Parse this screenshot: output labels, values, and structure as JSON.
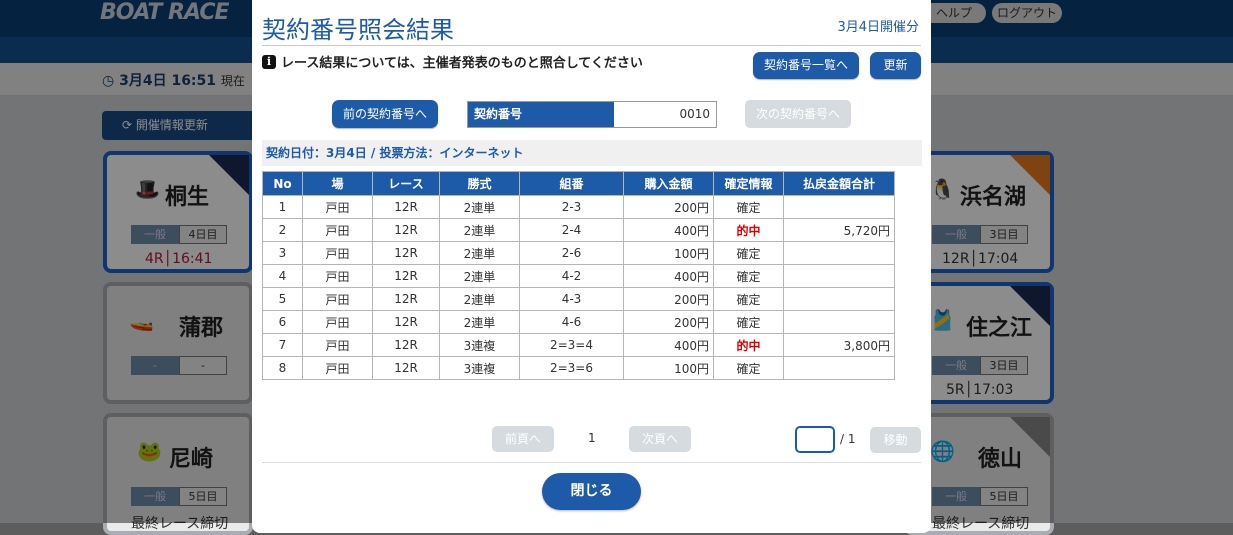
{
  "background": {
    "logo": "BOAT RACE",
    "header_buttons": [
      "ヘルプ",
      "ログアウト"
    ],
    "current_time": "3月4日 16:51",
    "current_time_suffix": "現在",
    "update_button": "開催情報更新",
    "venues": [
      {
        "name": "桐生",
        "tag1": "一般",
        "tag2": "4日目",
        "race": "4R",
        "time": "16:41"
      },
      {
        "name": "蒲郡",
        "tag1": "-",
        "tag2": "-"
      },
      {
        "name": "尼崎",
        "tag1": "一般",
        "tag2": "5日目",
        "status": "最終レース締切"
      },
      {
        "name": "浜名湖",
        "tag1": "一般",
        "tag2": "3日目",
        "race": "12R",
        "time": "17:04"
      },
      {
        "name": "住之江",
        "tag1": "一般",
        "tag2": "3日目",
        "race": "5R",
        "time": "17:03"
      },
      {
        "name": "徳山",
        "tag1": "一般",
        "tag2": "5日目",
        "status": "最終レース締切"
      }
    ]
  },
  "modal": {
    "title": "契約番号照会結果",
    "date_label": "3月4日開催分",
    "notice": "レース結果については、主催者発表のものと照合してください",
    "contract_list_button": "契約番号一覧へ",
    "refresh_button": "更新",
    "prev_contract_button": "前の契約番号へ",
    "next_contract_button": "次の契約番号へ",
    "contract_label": "契約番号",
    "contract_value": "0010",
    "sub_info": "契約日付：3月4日 / 投票方法：インターネット",
    "table": {
      "headers": [
        "No",
        "場",
        "レース",
        "勝式",
        "組番",
        "購入金額",
        "確定情報",
        "払戻金額合計"
      ],
      "rows": [
        [
          "1",
          "戸田",
          "12R",
          "2連単",
          "2-3",
          "200円",
          "確定",
          ""
        ],
        [
          "2",
          "戸田",
          "12R",
          "2連単",
          "2-4",
          "400円",
          "的中",
          "5,720円"
        ],
        [
          "3",
          "戸田",
          "12R",
          "2連単",
          "2-6",
          "100円",
          "確定",
          ""
        ],
        [
          "4",
          "戸田",
          "12R",
          "2連単",
          "4-2",
          "400円",
          "確定",
          ""
        ],
        [
          "5",
          "戸田",
          "12R",
          "2連単",
          "4-3",
          "200円",
          "確定",
          ""
        ],
        [
          "6",
          "戸田",
          "12R",
          "2連単",
          "4-6",
          "200円",
          "確定",
          ""
        ],
        [
          "7",
          "戸田",
          "12R",
          "3連複",
          "2=3=4",
          "400円",
          "的中",
          "3,800円"
        ],
        [
          "8",
          "戸田",
          "12R",
          "3連複",
          "2=3=6",
          "100円",
          "確定",
          ""
        ]
      ]
    },
    "pagination": {
      "prev_label": "前頁へ",
      "current_page": "1",
      "next_label": "次頁へ",
      "page_input_value": "",
      "total_pages": "/ 1",
      "go_label": "移動"
    },
    "close_button": "閉じる"
  },
  "colors": {
    "primary": "#1d5aa8",
    "hit": "#dd0000",
    "disabled": "#d6dbe0"
  }
}
